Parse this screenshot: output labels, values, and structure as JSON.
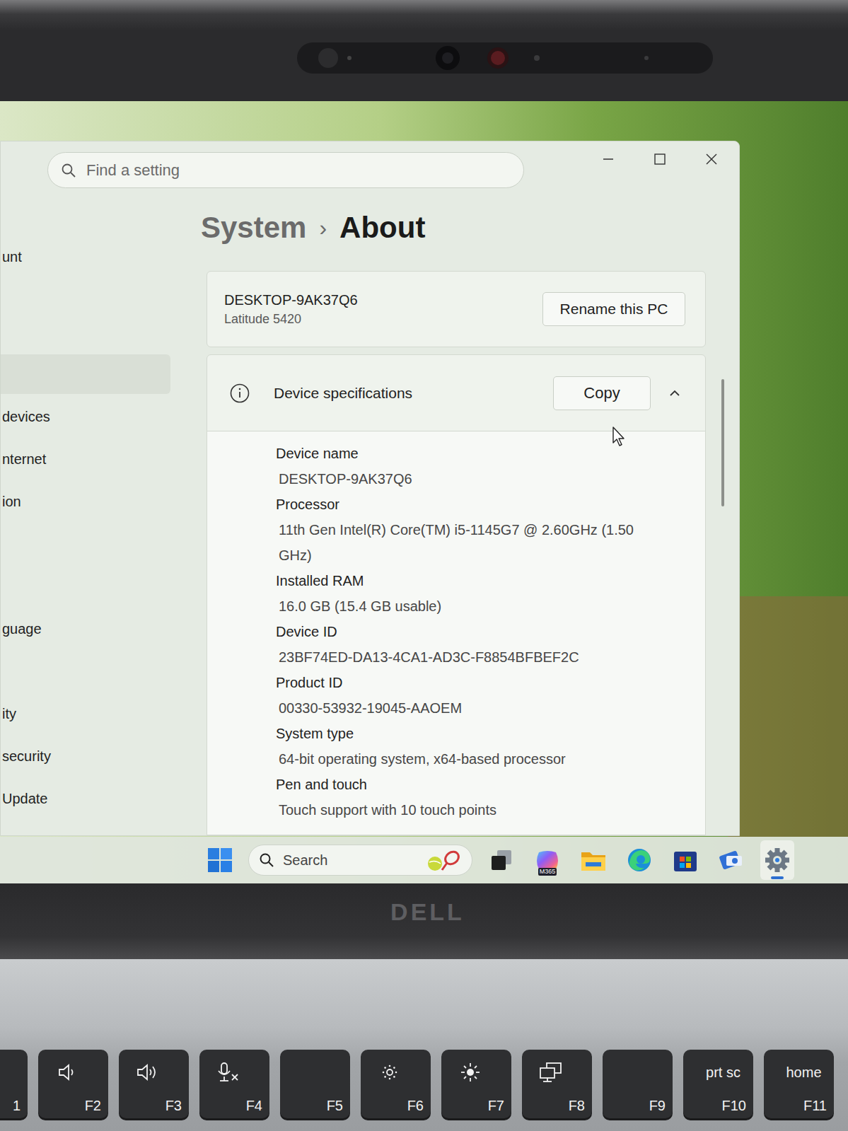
{
  "settings": {
    "search_placeholder": "Find a setting",
    "breadcrumb": {
      "parent": "System",
      "separator": "›",
      "current": "About"
    },
    "sidebar": {
      "items": [
        {
          "label": "unt",
          "selected": false
        },
        {
          "label": "",
          "selected": true
        },
        {
          "label": "devices",
          "selected": false
        },
        {
          "label": "nternet",
          "selected": false
        },
        {
          "label": "ion",
          "selected": false
        },
        {
          "label": "",
          "selected": false
        },
        {
          "label": "",
          "selected": false
        },
        {
          "label": "guage",
          "selected": false
        },
        {
          "label": "",
          "selected": false
        },
        {
          "label": "ity",
          "selected": false
        },
        {
          "label": "security",
          "selected": false
        },
        {
          "label": "Update",
          "selected": false
        }
      ]
    },
    "pc_card": {
      "name": "DESKTOP-9AK37Q6",
      "model": "Latitude 5420",
      "rename_button": "Rename this PC"
    },
    "specs": {
      "title": "Device specifications",
      "copy_button": "Copy",
      "expanded": true,
      "items": [
        {
          "label": "Device name",
          "value": "DESKTOP-9AK37Q6"
        },
        {
          "label": "Processor",
          "value": "11th Gen Intel(R) Core(TM) i5-1145G7 @ 2.60GHz (1.50 GHz)"
        },
        {
          "label": "Installed RAM",
          "value": "16.0 GB (15.4 GB usable)"
        },
        {
          "label": "Device ID",
          "value": "23BF74ED-DA13-4CA1-AD3C-F8854BFBEF2C"
        },
        {
          "label": "Product ID",
          "value": "00330-53932-19045-AAOEM"
        },
        {
          "label": "System type",
          "value": "64-bit operating system, x64-based processor"
        },
        {
          "label": "Pen and touch",
          "value": "Touch support with 10 touch points"
        }
      ]
    }
  },
  "taskbar": {
    "search_placeholder": "Search",
    "apps": [
      {
        "kind": "task-view",
        "active": false
      },
      {
        "kind": "m365",
        "label": "M365",
        "active": false
      },
      {
        "kind": "explorer",
        "active": false
      },
      {
        "kind": "edge",
        "active": false
      },
      {
        "kind": "store",
        "active": false
      },
      {
        "kind": "app",
        "active": false
      },
      {
        "kind": "settings",
        "active": true
      }
    ]
  },
  "bezel": {
    "logo": "DELL"
  },
  "keys": [
    {
      "label": "1",
      "kind": "blank"
    },
    {
      "label": "F2",
      "kind": "volume-down"
    },
    {
      "label": "F3",
      "kind": "volume-up"
    },
    {
      "label": "F4",
      "kind": "mic-mute"
    },
    {
      "label": "F5",
      "kind": "blank"
    },
    {
      "label": "F6",
      "kind": "brightness-down"
    },
    {
      "label": "F7",
      "kind": "brightness-up"
    },
    {
      "label": "F8",
      "kind": "display"
    },
    {
      "label": "F9",
      "kind": "blank"
    },
    {
      "label": "F10",
      "kind": "text",
      "top": "prt sc"
    },
    {
      "label": "F11",
      "kind": "text",
      "top": "home"
    }
  ]
}
